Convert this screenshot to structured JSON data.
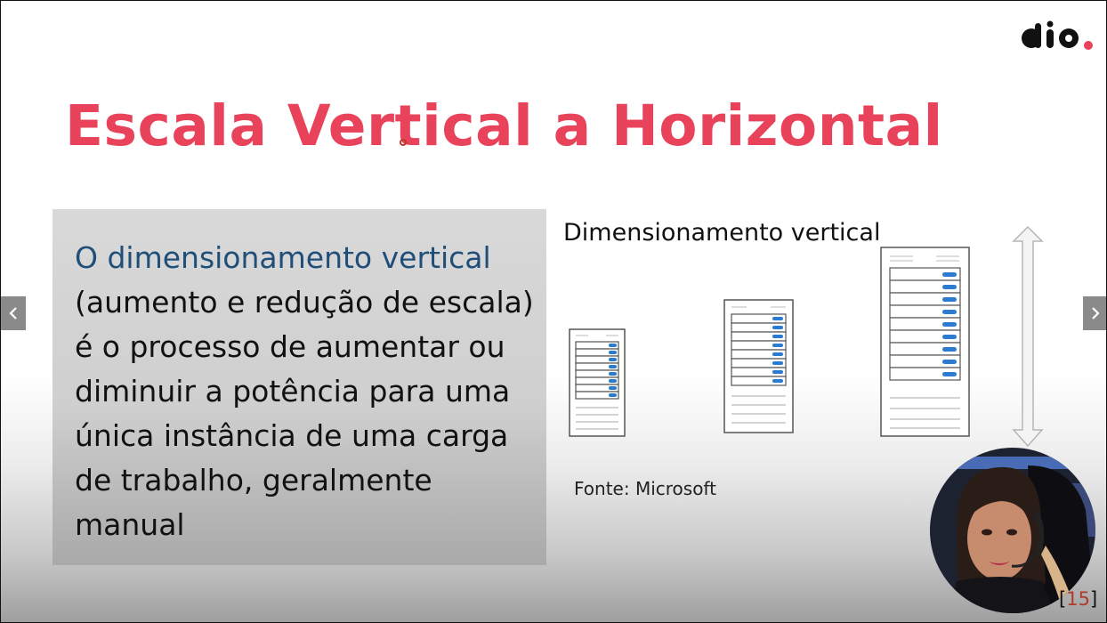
{
  "slide": {
    "title": "Escala Vertical a Horizontal",
    "body_highlight": "O dimensionamento vertical",
    "body_text": "(aumento e redução de escala) é o processo de aumentar ou diminuir a potência para uma única instância de uma carga de trabalho, geralmente manual",
    "diagram_title": "Dimensionamento vertical",
    "diagram_source": "Fonte: Microsoft",
    "page_open": "[",
    "page_number": "15",
    "page_close": "]"
  },
  "brand": {
    "logo_icon": "dio-logo-icon",
    "accent_color": "#e8435b",
    "highlight_color": "#1f4e79"
  },
  "nav": {
    "prev_icon": "chevron-left-icon",
    "next_icon": "chevron-right-icon"
  }
}
